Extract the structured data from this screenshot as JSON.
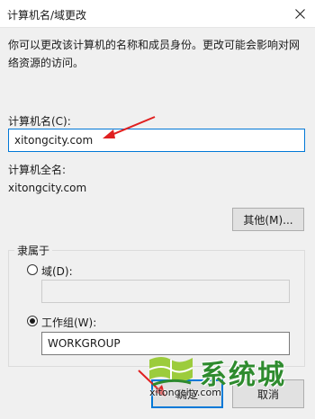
{
  "window": {
    "title": "计算机名/域更改"
  },
  "description": "你可以更改该计算机的名称和成员身份。更改可能会影响对网络资源的访问。",
  "computer_name": {
    "label": "计算机名(C):",
    "value": "xitongcity.com"
  },
  "full_name": {
    "label": "计算机全名:",
    "value": "xitongcity.com"
  },
  "more_button": "其他(M)...",
  "member_of": {
    "label": "隶属于",
    "domain": {
      "label": "域(D):",
      "value": "",
      "selected": false
    },
    "workgroup": {
      "label": "工作组(W):",
      "value": "WORKGROUP",
      "selected": true
    }
  },
  "buttons": {
    "ok": "确定",
    "cancel": "取消"
  },
  "watermark": {
    "brand": "系统城",
    "url": "xitongcity.com"
  },
  "colors": {
    "accent": "#0078d7",
    "annotation_arrow": "#e02020",
    "watermark_green": "#2e8b2e"
  }
}
